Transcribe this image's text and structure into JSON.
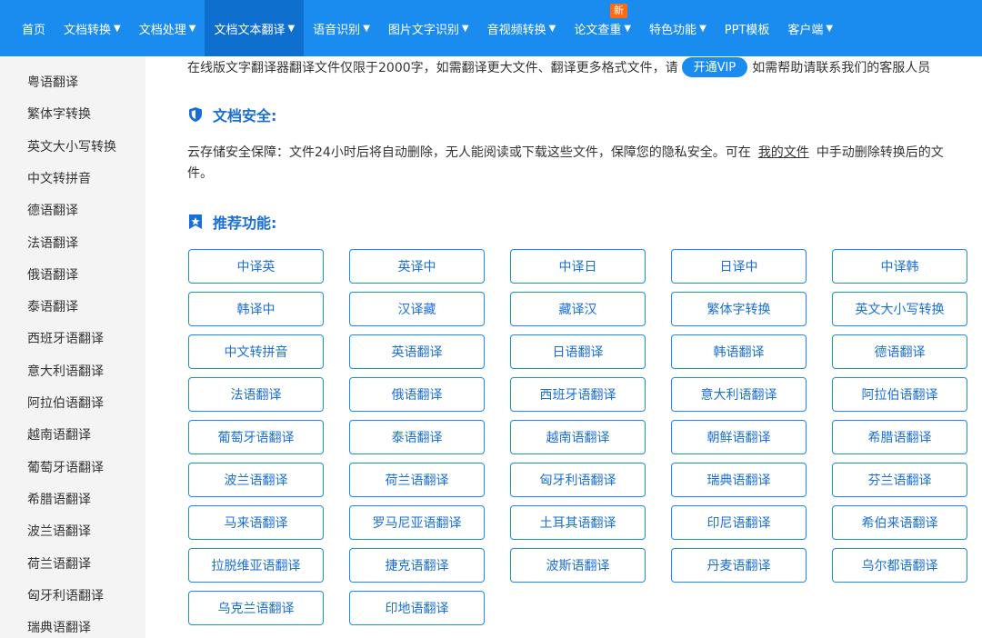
{
  "nav": {
    "items": [
      {
        "label": "首页",
        "caret": false
      },
      {
        "label": "文档转换",
        "caret": true
      },
      {
        "label": "文档处理",
        "caret": true
      },
      {
        "label": "文档文本翻译",
        "caret": true,
        "active": true
      },
      {
        "label": "语音识别",
        "caret": true
      },
      {
        "label": "图片文字识别",
        "caret": true
      },
      {
        "label": "音视频转换",
        "caret": true
      },
      {
        "label": "论文查重",
        "caret": true,
        "badge": "新"
      },
      {
        "label": "特色功能",
        "caret": true
      },
      {
        "label": "PPT模板",
        "caret": false
      },
      {
        "label": "客户端",
        "caret": true
      }
    ],
    "caret_glyph": "▼",
    "colors": {
      "bar": "#1a8cf0",
      "active": "#0f6fcf",
      "badge": "#ff6a13"
    }
  },
  "sidebar": {
    "items": [
      "粤语翻译",
      "繁体字转换",
      "英文大小写转换",
      "中文转拼音",
      "德语翻译",
      "法语翻译",
      "俄语翻译",
      "泰语翻译",
      "西班牙语翻译",
      "意大利语翻译",
      "阿拉伯语翻译",
      "越南语翻译",
      "葡萄牙语翻译",
      "希腊语翻译",
      "波兰语翻译",
      "荷兰语翻译",
      "匈牙利语翻译",
      "瑞典语翻译"
    ]
  },
  "notice": {
    "text_before": "在线版文字翻译器翻译文件仅限于2000字，如需翻译更大文件、翻译更多格式文件，请",
    "vip_button": "开通VIP",
    "text_after": "如需帮助请联系我们的客服人员"
  },
  "security": {
    "title": "文档安全:",
    "line1_before": "云存储安全保障：文件24小时后将自动删除，无人能阅读或下载这些文件，保障您的隐私安全。可在",
    "link": "我的文件",
    "line1_after": "中手动删除转换后的文",
    "line2": "件。"
  },
  "recommend": {
    "title": "推荐功能:",
    "items": [
      "中译英",
      "英译中",
      "中译日",
      "日译中",
      "中译韩",
      "韩译中",
      "汉译藏",
      "藏译汉",
      "繁体字转换",
      "英文大小写转换",
      "中文转拼音",
      "英语翻译",
      "日语翻译",
      "韩语翻译",
      "德语翻译",
      "法语翻译",
      "俄语翻译",
      "西班牙语翻译",
      "意大利语翻译",
      "阿拉伯语翻译",
      "葡萄牙语翻译",
      "泰语翻译",
      "越南语翻译",
      "朝鲜语翻译",
      "希腊语翻译",
      "波兰语翻译",
      "荷兰语翻译",
      "匈牙利语翻译",
      "瑞典语翻译",
      "芬兰语翻译",
      "马来语翻译",
      "罗马尼亚语翻译",
      "土耳其语翻译",
      "印尼语翻译",
      "希伯来语翻译",
      "拉脱维亚语翻译",
      "捷克语翻译",
      "波斯语翻译",
      "丹麦语翻译",
      "乌尔都语翻译",
      "乌克兰语翻译",
      "印地语翻译"
    ]
  },
  "icons": {
    "security": "shield-icon",
    "recommend": "star-bookmark-icon"
  },
  "accent_color": "#1a8cf0"
}
